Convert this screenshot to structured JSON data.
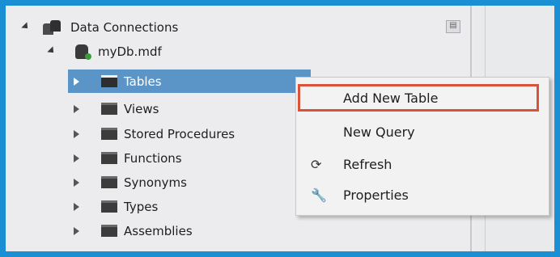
{
  "tree": {
    "root": "Data Connections",
    "db": "myDb.mdf",
    "items": [
      "Tables",
      "Views",
      "Stored Procedures",
      "Functions",
      "Synonyms",
      "Types",
      "Assemblies"
    ]
  },
  "menu": {
    "add_new_table": "Add New Table",
    "new_query": "New Query",
    "refresh": "Refresh",
    "properties": "Properties"
  },
  "colors": {
    "frame": "#1a8fd3",
    "selection": "#5b95c8",
    "highlight_border": "#d9533a"
  },
  "icons": {
    "refresh": "refresh-icon",
    "properties": "wrench-icon"
  }
}
